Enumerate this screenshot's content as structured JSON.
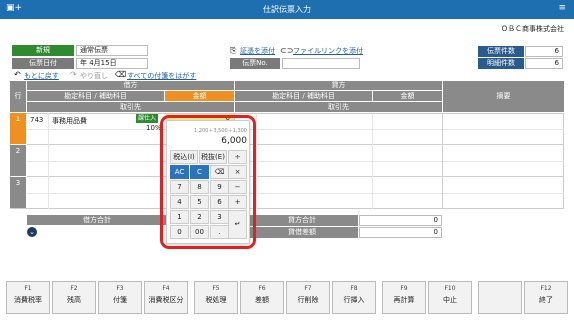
{
  "window": {
    "title": "仕訳伝票入力",
    "app_icon": "document-plus-icon"
  },
  "company": "ＯＢＣ商事株式会社",
  "voucher": {
    "mode_label": "新規",
    "type_value": "通常伝票",
    "date_label": "伝票日付",
    "date_value": "年 4月15日",
    "number_label": "伝票No.",
    "attach_link": "証憑を添付",
    "filelink_link": "ファイルリンクを添付",
    "undo": "もとに戻す",
    "redo": "やり直し",
    "remove_attach": "すべての付箋をはがす"
  },
  "counts": {
    "slip_count_label": "伝票件数",
    "slip_count_value": "6",
    "detail_count_label": "明細件数",
    "detail_count_value": "6"
  },
  "grid": {
    "row_header": "行",
    "debit_header": "借方",
    "credit_header": "貸方",
    "account_header": "勘定科目 / 補助科目",
    "amount_header": "金額",
    "partner_header": "取引先",
    "memo_header": "摘要",
    "rows": [
      {
        "num": "1",
        "code": "743",
        "account": "事務用品費",
        "tax_badge": "課仕入",
        "amount": "0",
        "rate": "10%"
      },
      {
        "num": "2"
      },
      {
        "num": "3"
      }
    ]
  },
  "totals": {
    "debit_total_label": "借方合計",
    "credit_total_label": "貸方合計",
    "credit_total_value": "0",
    "diff_label": "貸借差額",
    "diff_value": "0"
  },
  "calculator": {
    "expression": "1,200＋3,500＋1,300",
    "result": "6,000",
    "keys": {
      "tax_in": "税込(I)",
      "tax_out": "税抜(E)",
      "divide": "÷",
      "ac": "AC",
      "c": "C",
      "backspace": "⌫",
      "multiply": "×",
      "k7": "7",
      "k8": "8",
      "k9": "9",
      "minus": "−",
      "k4": "4",
      "k5": "5",
      "k6": "6",
      "plus": "+",
      "k1": "1",
      "k2": "2",
      "k3": "3",
      "k0": "0",
      "k00": "00",
      "dot": ".",
      "enter": "↵"
    }
  },
  "fkeys": [
    {
      "key": "F1",
      "label": "消費税率"
    },
    {
      "key": "F2",
      "label": "残高"
    },
    {
      "key": "F3",
      "label": "付箋"
    },
    {
      "key": "F4",
      "label": "消費税区分"
    },
    {
      "key": "F5",
      "label": "税処理"
    },
    {
      "key": "F6",
      "label": "差額"
    },
    {
      "key": "F7",
      "label": "行削除"
    },
    {
      "key": "F8",
      "label": "行挿入"
    },
    {
      "key": "F9",
      "label": "再計算"
    },
    {
      "key": "F10",
      "label": "中止"
    },
    {
      "key": "",
      "label": ""
    },
    {
      "key": "F12",
      "label": "終了"
    }
  ]
}
